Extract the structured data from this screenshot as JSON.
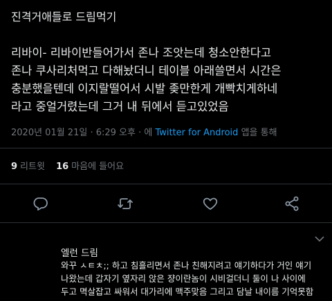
{
  "header": {
    "text": "진격거애들로 드림먹기"
  },
  "tweet": {
    "lines": [
      "리바이- 리바이반들어가서 존나 조앗는데 청소안한다고",
      "존나 쿠사리처먹고 다해놨더니 테이블 아래쓸면서 시간은",
      "충분했을텐데 이지랄떨어서 시발 좆만한게 개빡치게하네",
      "라고 중얼거렸는데 그거 내 뒤에서 듣고있었음"
    ],
    "date": "2020년 01월 21일 · 6:29 오후 · 에",
    "client": "Twitter for Android",
    "via": "앱을 통해"
  },
  "stats": {
    "retweets_count": "9",
    "retweets_label": "리트윗",
    "likes_count": "16",
    "likes_label": "마음에 들어요"
  },
  "actions": {
    "reply": "reply-icon",
    "retweet": "retweet-icon",
    "like": "heart-icon",
    "share": "share-icon"
  },
  "reply": {
    "author": "엘런 드림",
    "lines": [
      "와꾸 ㅅㅌㅊ;; 하고 침흘리면서 존나 친해지려고 얘기하다가 거인 얘기",
      "나왔는데 갑자기 옆자리 앉은 쟝이란놈이 시비걸더니 둘이 나 사이에",
      "두고 멱살잡고 싸워서 대가리에 맥주맞음 그리고 담날 내이름 기억못함"
    ]
  },
  "colors": {
    "background": "#000000",
    "text": "#e7e9ea",
    "muted": "#71767b",
    "link": "#1d9bf0",
    "divider": "#2f3336"
  }
}
